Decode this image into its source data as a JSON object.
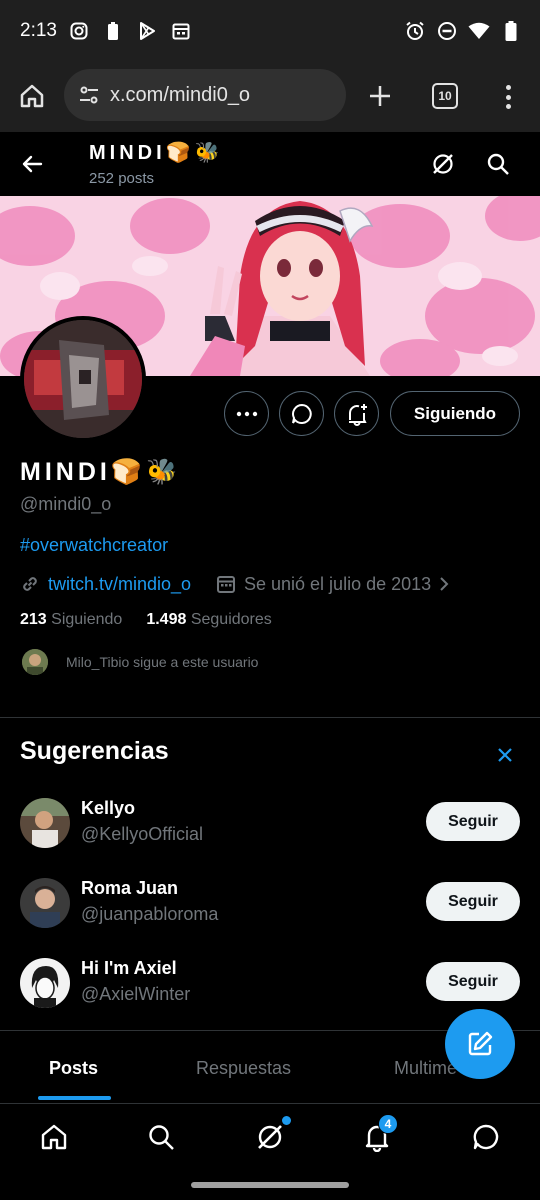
{
  "status_bar": {
    "time": "2:13"
  },
  "browser": {
    "url": "x.com/mindi0_o",
    "tab_count": "10"
  },
  "profile": {
    "name": "MINDI🍞🐝",
    "post_count": "252 posts",
    "handle": "@mindi0_o",
    "bio_hashtag": "#overwatchcreator",
    "website": "twitch.tv/mindio_o",
    "joined": "Se unió el julio de 2013",
    "following_count": "213",
    "following_label": "Siguiendo",
    "followers_count": "1.498",
    "followers_label": "Seguidores",
    "followed_by": "Milo_Tibio sigue a este usuario",
    "following_button": "Siguiendo"
  },
  "suggestions": {
    "title": "Sugerencias",
    "items": [
      {
        "name": "Kellyo",
        "handle": "@KellyoOfficial",
        "button": "Seguir"
      },
      {
        "name": "Roma Juan",
        "handle": "@juanpabloroma",
        "button": "Seguir"
      },
      {
        "name": "Hi I'm Axiel",
        "handle": "@AxielWinter",
        "button": "Seguir"
      }
    ]
  },
  "tabs": [
    {
      "label": "Posts",
      "active": true
    },
    {
      "label": "Respuestas",
      "active": false
    },
    {
      "label": "Multime",
      "active": false
    }
  ],
  "bottom_nav": {
    "items": [
      "home-icon",
      "search-icon",
      "grok-icon",
      "notifications-icon",
      "messages-icon"
    ],
    "notification_badge": "4"
  },
  "colors": {
    "accent": "#1d9bf0",
    "background": "#000000",
    "muted_text": "#71767b",
    "banner_pink": "#f7c6dd"
  }
}
